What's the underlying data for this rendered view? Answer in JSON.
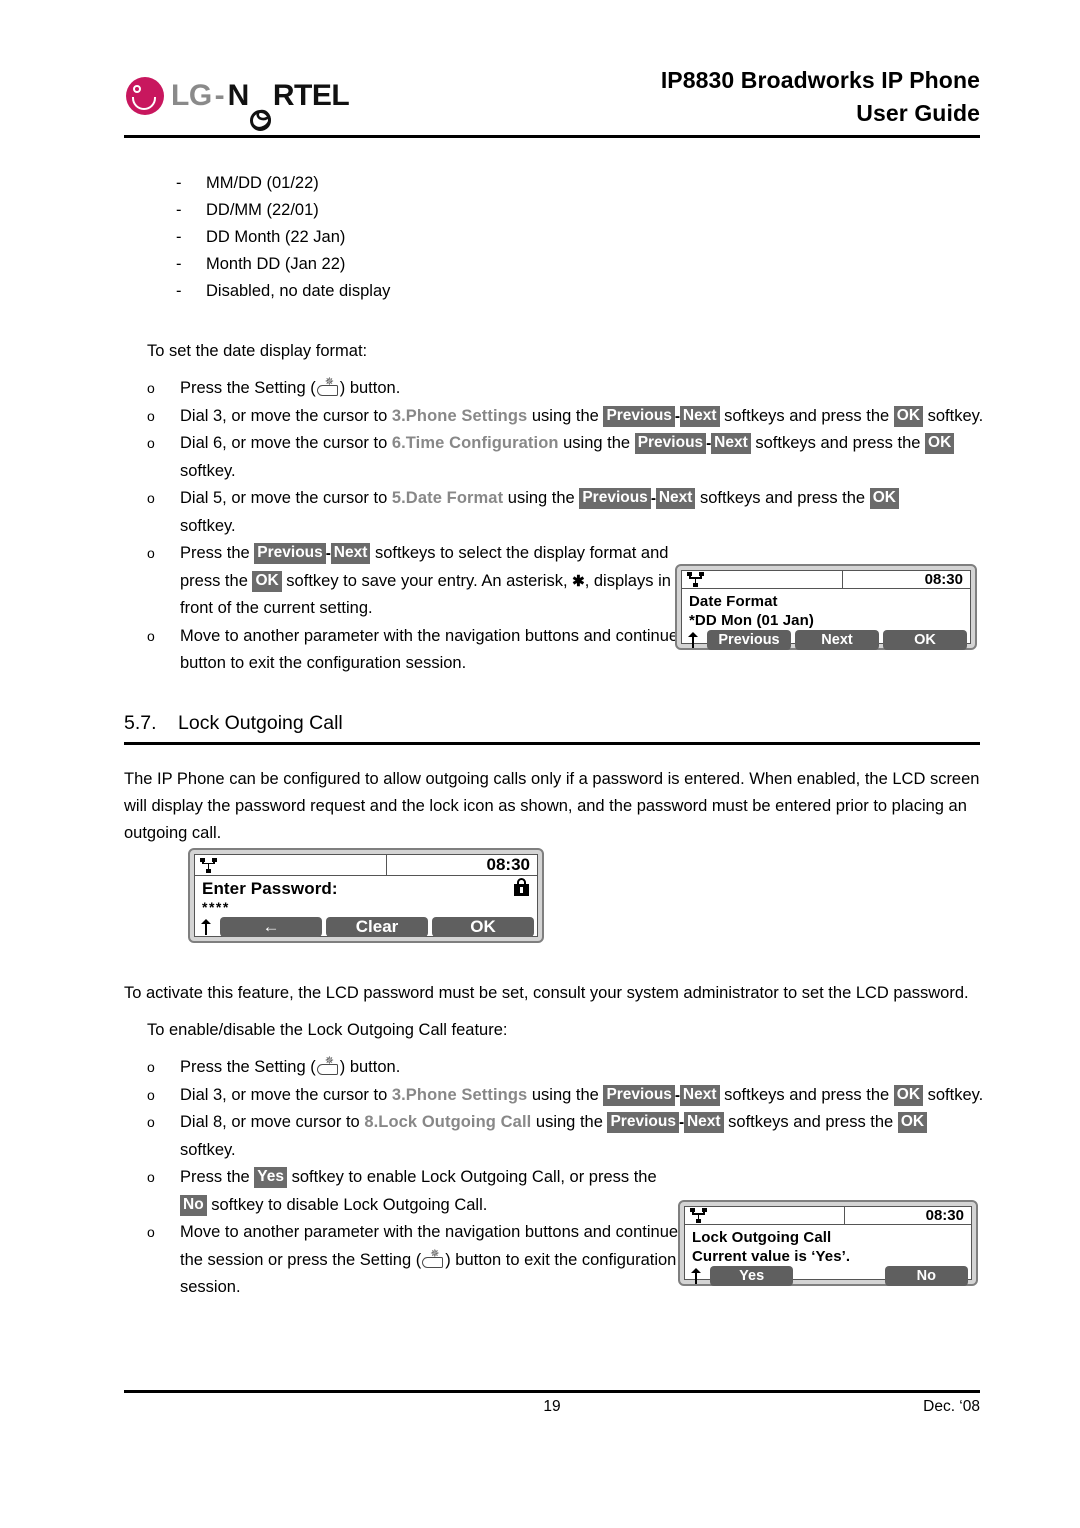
{
  "header": {
    "logo_lg": "LG",
    "logo_dash": "-",
    "logo_nortel_pre": "N",
    "logo_nortel_post": "RTEL",
    "title_line1": "IP8830 Broadworks IP Phone",
    "title_line2": "User Guide"
  },
  "date_formats": [
    {
      "dash": "-",
      "text": "MM/DD  (01/22)"
    },
    {
      "dash": "-",
      "text": "DD/MM  (22/01)"
    },
    {
      "dash": "-",
      "text": "DD Month  (22 Jan)"
    },
    {
      "dash": "-",
      "text": "Month DD  (Jan 22)"
    },
    {
      "dash": "-",
      "text": "Disabled, no date display"
    }
  ],
  "intro": {
    "set_date_format": "To set the date display format:"
  },
  "bullets_date": {
    "b1_a": "Press the Setting (",
    "b1_b": ") button.",
    "b2_a": "Dial 3, or move the cursor to ",
    "b2_menu": "3.Phone Settings",
    "b2_b": " using the ",
    "b2_chip1": "Previous",
    "b2_sep": "-",
    "b2_chip2": "Next",
    "b2_c": " softkeys and press the ",
    "b2_chip3": "OK",
    "b2_d": " softkey.",
    "b3_a": "Dial 6, or move the cursor to ",
    "b3_menu": "6.Time Configuration",
    "b3_b": " using the ",
    "b3_chip1": "Previous",
    "b3_sep": "-",
    "b3_chip2": "Next",
    "b3_c": " softkeys and press the ",
    "b3_chip3": "OK",
    "b3_d": " softkey.",
    "b4_a": "Dial 5, or move the cursor to ",
    "b4_menu": "5.Date Format",
    "b4_b": " using the ",
    "b4_chip1": "Previous",
    "b4_sep": "-",
    "b4_chip2": "Next",
    "b4_c": " softkeys and press the ",
    "b4_chip3": "OK",
    "b4_d": "softkey.",
    "b5_a": "Press the ",
    "b5_chip1": "Previous",
    "b5_sep": "-",
    "b5_chip2": "Next",
    "b5_b": " softkeys to select the display format and press the ",
    "b5_chip3": "OK",
    "b5_c": " softkey to save your entry.  An asterisk, ",
    "b5_ast": "✱",
    "b5_d": ", displays in front of the current setting.",
    "b6_a": "Move to another parameter with the navigation buttons and continue the session or press the Setting (",
    "b6_b": ") button to exit the configuration session."
  },
  "lcd_date_format": {
    "time": "08:30",
    "line1": "Date Format",
    "line2": "*DD Mon (01 Jan)",
    "key1": "Previous",
    "key2": "Next",
    "key3": "OK"
  },
  "section": {
    "number": "5.7.",
    "title": "Lock Outgoing Call",
    "paragraph": "The IP Phone can be configured to allow outgoing calls only if a password is entered.  When enabled, the LCD screen will display the password request and the lock icon as shown, and the password must be entered prior to placing an outgoing call."
  },
  "lcd_password": {
    "time": "08:30",
    "line1": "Enter Password:",
    "line2": "****",
    "key1": "←",
    "key2": "Clear",
    "key3": "OK"
  },
  "activate": {
    "paragraph": "To activate this feature, the LCD password must be set, consult your system administrator to set the LCD password.",
    "intro": "To enable/disable the Lock Outgoing Call feature:"
  },
  "bullets_lock": {
    "b1_a": "Press the Setting (",
    "b1_b": ") button.",
    "b2_a": "Dial 3, or move the cursor to ",
    "b2_menu": "3.Phone Settings",
    "b2_b": " using the ",
    "b2_chip1": "Previous",
    "b2_sep": "-",
    "b2_chip2": "Next",
    "b2_c": " softkeys and press the ",
    "b2_chip3": "OK",
    "b2_d": " softkey.",
    "b3_a": "Dial 8, or move cursor to ",
    "b3_menu": "8.Lock Outgoing Call",
    "b3_b": " using the ",
    "b3_chip1": "Previous",
    "b3_sep": "-",
    "b3_chip2": "Next",
    "b3_c": " softkeys and press the ",
    "b3_chip3": "OK",
    "b3_d": " softkey.",
    "b4_a": "Press the ",
    "b4_chip1": "Yes",
    "b4_b": " softkey to enable Lock Outgoing Call, or press the ",
    "b4_chip2": "No",
    "b4_c": " softkey to disable Lock Outgoing Call.",
    "b5_a": "Move to another parameter with the navigation buttons and continue the session or press the Setting (",
    "b5_b": ") button to exit the configuration session."
  },
  "lcd_lock": {
    "time": "08:30",
    "line1": "Lock Outgoing Call",
    "line2": "Current value is ‘Yes’.",
    "key1": "Yes",
    "key2": "No"
  },
  "footer": {
    "page": "19",
    "date": "Dec. ‘08"
  },
  "colors": {
    "brand": "#c8175e",
    "chip_bg": "#6b6b6b",
    "menu_ref": "#888888",
    "lcd_bezel": "#d4d4d4",
    "softkey": "#5f5f5f"
  }
}
